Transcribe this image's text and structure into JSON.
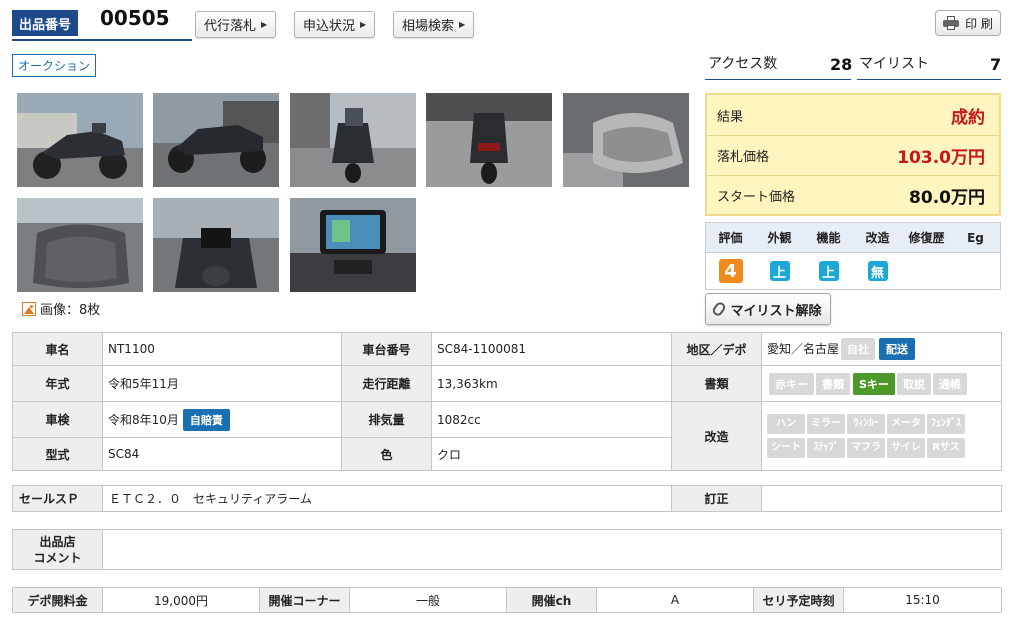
{
  "header": {
    "lot_label": "出品番号",
    "lot_number": "00505",
    "buttons": [
      "代行落札",
      "申込状況",
      "相場検索"
    ],
    "print_label": "印 刷",
    "auction_tag": "オークション"
  },
  "stats": {
    "access_label": "アクセス数",
    "access_value": "28",
    "mylist_label": "マイリスト",
    "mylist_value": "7"
  },
  "images": {
    "count_label": "画像：8枚"
  },
  "result": {
    "result_label": "結果",
    "result_value": "成約",
    "price_label": "落札価格",
    "price_value": "103.0万円",
    "start_label": "スタート価格",
    "start_value": "80.0万円"
  },
  "rating": {
    "headers": [
      "評価",
      "外観",
      "機能",
      "改造",
      "修復歴",
      "Eg"
    ],
    "score": "4",
    "exterior": "上",
    "function": "上",
    "modification": "無"
  },
  "mylist_button": "マイリスト解除",
  "spec": {
    "name_label": "車名",
    "name_value": "NT1100",
    "frame_label": "車台番号",
    "frame_value": "SC84-1100081",
    "region_label": "地区／デポ",
    "region_value": "愛知／名古屋",
    "self_tag": "自社",
    "ship_tag": "配送",
    "year_label": "年式",
    "year_value": "令和5年11月",
    "mileage_label": "走行距離",
    "mileage_value": "13,363km",
    "docs_label": "書類",
    "docs_tags": [
      "赤キー",
      "書類",
      "Sキー",
      "取説",
      "通帳"
    ],
    "inspection_label": "車検",
    "inspection_value": "令和8年10月",
    "insurance_tag": "自賠責",
    "displacement_label": "排気量",
    "displacement_value": "1082cc",
    "mod_label": "改造",
    "mod_tags": [
      "ハン",
      "ミラー",
      "ｳｨﾝｶｰ",
      "メータ",
      "ﾌｪﾝﾀﾞｽ",
      "シート",
      "ｽﾃｯﾌﾟ",
      "マフラ",
      "サイレ",
      "Rサス"
    ],
    "model_label": "型式",
    "model_value": "SC84",
    "color_label": "色",
    "color_value": "クロ"
  },
  "sales": {
    "label": "セールスＰ",
    "value": "ＥＴＣ２．０　セキュリティアラーム",
    "correction_label": "訂正",
    "correction_value": ""
  },
  "comment": {
    "label": "出品店コメント",
    "value": ""
  },
  "bottom": {
    "fee_label": "デポ開料金",
    "fee_value": "19,000円",
    "corner_label": "開催コーナー",
    "corner_value": "一般",
    "ch_label": "開催ch",
    "ch_value": "A",
    "time_label": "セリ予定時刻",
    "time_value": "15:10"
  },
  "colors": {
    "brand_blue": "#1f4a8a",
    "price_red": "#c8161d",
    "score_orange": "#f08a1c",
    "grade_cyan": "#1ba8d6",
    "result_bg": "#fff5bf"
  }
}
